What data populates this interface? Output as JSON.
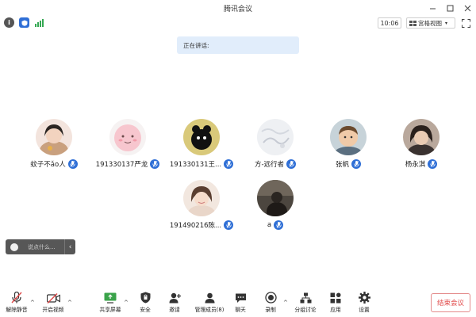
{
  "window": {
    "title": "腾讯会议"
  },
  "status": {
    "time": "10:06",
    "view_mode": "宫格视图"
  },
  "banner": {
    "speaking_label": "正在讲话:"
  },
  "participants": [
    {
      "name": "蚊子不ǎo人"
    },
    {
      "name": "191330137严龙"
    },
    {
      "name": "191330131王..."
    },
    {
      "name": "方-远行者"
    },
    {
      "name": "张帆"
    },
    {
      "name": "杨永淇"
    },
    {
      "name": "191490216陈..."
    },
    {
      "name": "a"
    }
  ],
  "chat": {
    "placeholder": "说点什么..."
  },
  "toolbar": {
    "unmute": "解除静音",
    "start_video": "开启视频",
    "share_screen": "共享屏幕",
    "security": "安全",
    "invite": "邀请",
    "manage_members": "管理成员(8)",
    "chat": "聊天",
    "record": "录制",
    "breakout": "分组讨论",
    "apps": "应用",
    "settings": "设置",
    "end_meeting": "结束会议"
  },
  "colors": {
    "accent_blue": "#2f6fd6",
    "banner_bg": "#e1edfb",
    "end_red": "#e04848",
    "signal_green": "#35a853"
  }
}
